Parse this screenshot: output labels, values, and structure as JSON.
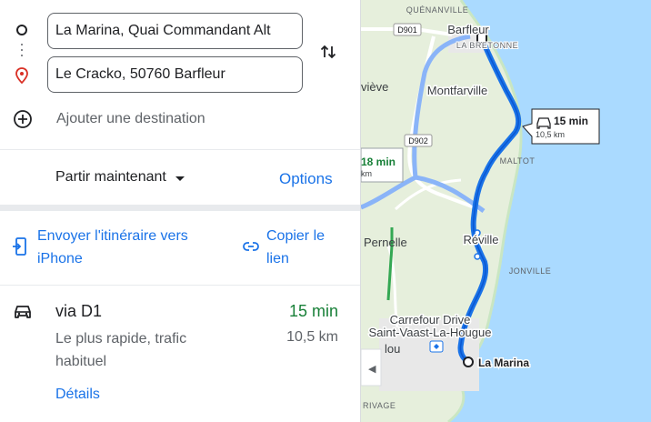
{
  "directions": {
    "origin_value": "La Marina, Quai Commandant Alt",
    "destination_value": "Le Cracko, 50760 Barfleur",
    "add_destination": "Ajouter une destination",
    "depart_label": "Partir maintenant",
    "options_label": "Options",
    "send_to_phone": [
      "Envoyer l'itinéraire vers",
      "iPhone"
    ],
    "copy_link": [
      "Copier le",
      "lien"
    ]
  },
  "route": {
    "via": "via D1",
    "duration": "15 min",
    "description": [
      "Le plus rapide, trafic",
      "habituel"
    ],
    "distance": "10,5 km",
    "details_label": "Détails"
  },
  "map": {
    "place_labels": [
      "QUÉNANVILLE",
      "Barfleur",
      "LA BRETONNE",
      "Montfarville",
      "viève",
      "MALTOT",
      "Pernelle",
      "Réville",
      "JONVILLE",
      "Carrefour Drive",
      "Saint-Vaast-La-Hougue",
      "lou",
      "RIVAGE"
    ],
    "destination_marker_label": "La Marina",
    "road_labels": [
      "D901",
      "D902"
    ],
    "primary_route_callout": {
      "duration": "15 min",
      "distance": "10,5 km"
    },
    "alt_route_callout": {
      "duration": "18 min",
      "distance": "km"
    },
    "collapse_arrow": "◀",
    "colors": {
      "route": "#1a73e8",
      "alt_route": "#8ab4f8",
      "water": "#aadaff",
      "land": "#e6efdc",
      "alt_duration": "#188038"
    }
  }
}
